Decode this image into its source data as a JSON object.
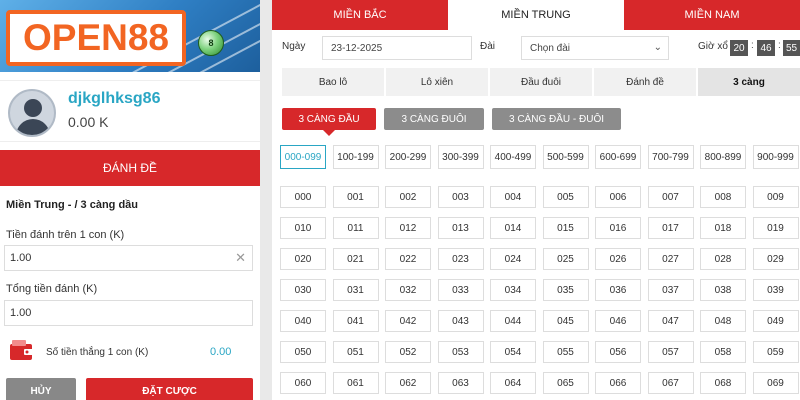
{
  "brand": {
    "logo_text": "OPEN88",
    "ball_number": "8",
    "accent": "#d7282a",
    "highlight": "#2aa6c4",
    "logo_orange": "#f26522"
  },
  "user": {
    "name": "djkglhksg86",
    "balance": "0.00 K"
  },
  "side_panel": {
    "header": "ĐÁNH ĐỀ",
    "section_title": "Miền Trung - / 3 càng dầu",
    "stake_label": "Tiền đánh trên 1 con (K)",
    "stake_value": "1.00",
    "total_label": "Tổng tiền đánh (K)",
    "total_value": "1.00",
    "win_label": "Số tiền thắng 1 con (K)",
    "win_value": "0.00",
    "cancel_label": "HỦY",
    "place_label": "ĐẶT CƯỢC"
  },
  "region_tabs": [
    {
      "label": "MIỀN BẮC",
      "active": false
    },
    {
      "label": "MIỀN TRUNG",
      "active": true
    },
    {
      "label": "MIỀN NAM",
      "active": false
    }
  ],
  "filters": {
    "date_label": "Ngày",
    "date_value": "23-12-2025",
    "station_label": "Đài",
    "station_value": "Chọn đài",
    "draw_time_label": "Giờ xổ",
    "hh": "20",
    "mm": "46",
    "ss": "55"
  },
  "bet_types": [
    {
      "label": "Bao lô",
      "active": false
    },
    {
      "label": "Lô xiên",
      "active": false
    },
    {
      "label": "Đầu đuôi",
      "active": false
    },
    {
      "label": "Đánh đề",
      "active": false
    },
    {
      "label": "3 càng",
      "active": true
    }
  ],
  "sub_types": [
    {
      "label": "3 CÀNG ĐẦU",
      "active": true
    },
    {
      "label": "3 CÀNG ĐUÔI",
      "active": false
    },
    {
      "label": "3 CÀNG ĐẦU - ĐUÔI",
      "active": false
    }
  ],
  "ranges": [
    "000-099",
    "100-199",
    "200-299",
    "300-399",
    "400-499",
    "500-599",
    "600-699",
    "700-799",
    "800-899",
    "900-999"
  ],
  "active_range_index": 0,
  "numbers": [
    [
      "000",
      "001",
      "002",
      "003",
      "004",
      "005",
      "006",
      "007",
      "008",
      "009"
    ],
    [
      "010",
      "011",
      "012",
      "013",
      "014",
      "015",
      "016",
      "017",
      "018",
      "019"
    ],
    [
      "020",
      "021",
      "022",
      "023",
      "024",
      "025",
      "026",
      "027",
      "028",
      "029"
    ],
    [
      "030",
      "031",
      "032",
      "033",
      "034",
      "035",
      "036",
      "037",
      "038",
      "039"
    ],
    [
      "040",
      "041",
      "042",
      "043",
      "044",
      "045",
      "046",
      "047",
      "048",
      "049"
    ],
    [
      "050",
      "051",
      "052",
      "053",
      "054",
      "055",
      "056",
      "057",
      "058",
      "059"
    ],
    [
      "060",
      "061",
      "062",
      "063",
      "064",
      "065",
      "066",
      "067",
      "068",
      "069"
    ]
  ]
}
